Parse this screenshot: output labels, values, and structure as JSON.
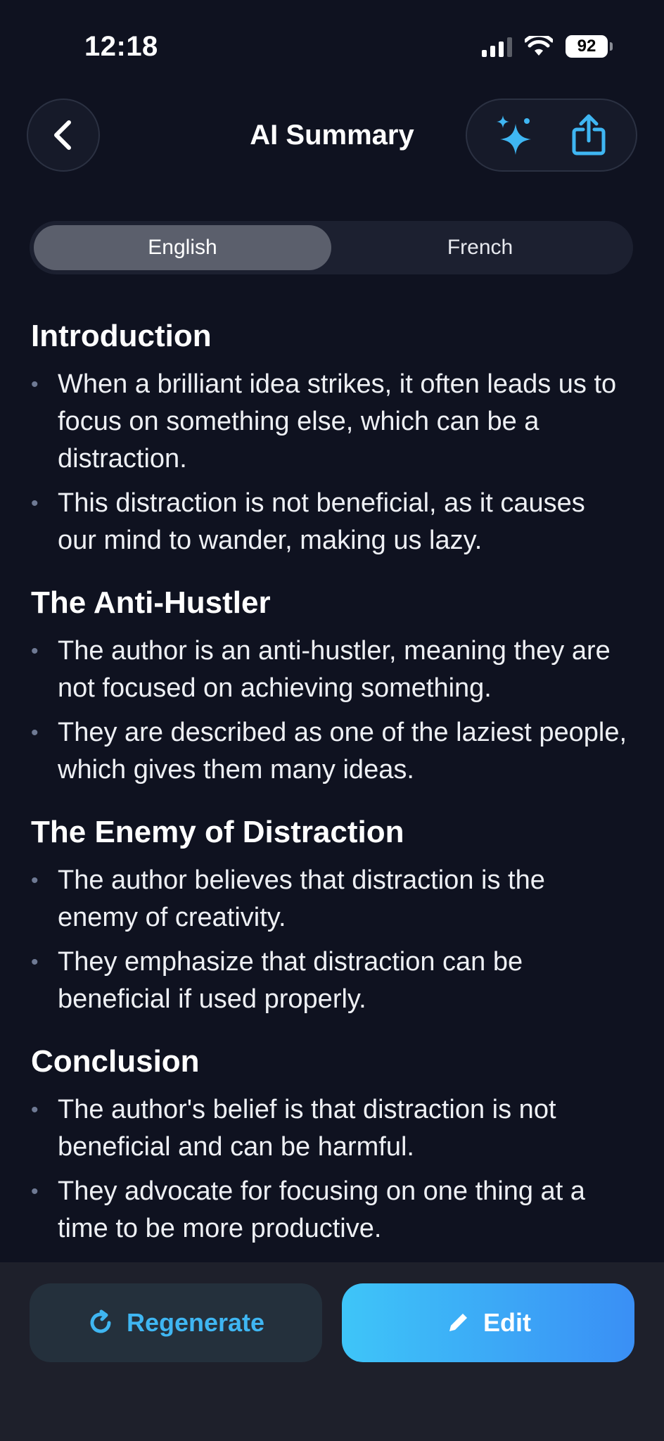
{
  "status_bar": {
    "time": "12:18",
    "battery": "92",
    "icons": [
      "signal-icon",
      "wifi-icon",
      "battery-icon"
    ]
  },
  "nav": {
    "title": "AI Summary",
    "icons": [
      "back-chevron-icon",
      "sparkles-icon",
      "share-icon"
    ]
  },
  "language_toggle": {
    "options": [
      "English",
      "French"
    ],
    "selected": "English"
  },
  "summary": {
    "sections": [
      {
        "title": "Introduction",
        "bullets": [
          "When a brilliant idea strikes, it often leads us to focus on something else, which can be a distraction.",
          "This distraction is not beneficial, as it causes our mind to wander, making us lazy."
        ]
      },
      {
        "title": "The Anti-Hustler",
        "bullets": [
          "The author is an anti-hustler, meaning they are not focused on achieving something.",
          "They are described as one of the laziest people, which gives them many ideas."
        ]
      },
      {
        "title": "The Enemy of Distraction",
        "bullets": [
          "The author believes that distraction is the enemy of creativity.",
          "They emphasize that distraction can be beneficial if used properly."
        ]
      },
      {
        "title": "Conclusion",
        "bullets": [
          "The author's belief is that distraction is not beneficial and can be harmful.",
          "They advocate for focusing on one thing at a time to be more productive."
        ]
      }
    ]
  },
  "actions": {
    "regenerate_label": "Regenerate",
    "edit_label": "Edit",
    "icons": [
      "refresh-icon",
      "pencil-icon"
    ]
  },
  "colors": {
    "background": "#0f1220",
    "accent": "#3fb6f2",
    "edit_gradient_start": "#3ec5f8",
    "edit_gradient_end": "#3a8ff5"
  }
}
